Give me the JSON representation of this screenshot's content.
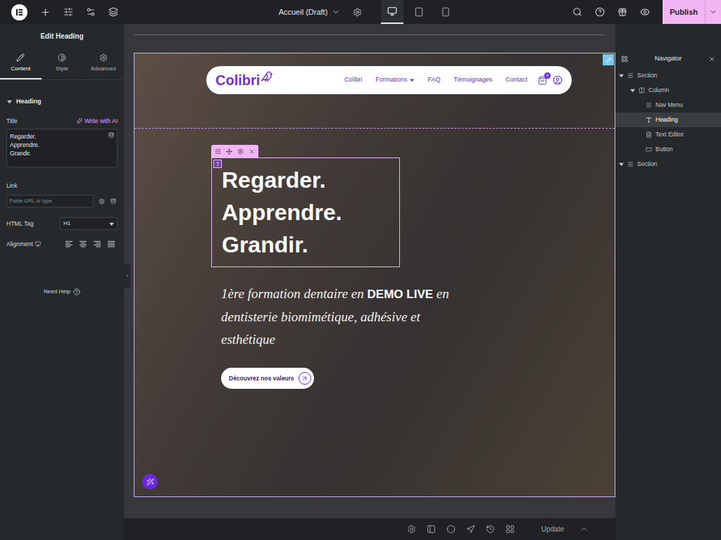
{
  "topbar": {
    "page_title": "Accueil (Draft)",
    "devices": [
      {
        "kind": "desktop",
        "selected": true
      },
      {
        "kind": "tablet",
        "selected": false
      },
      {
        "kind": "mobile",
        "selected": false
      }
    ],
    "publish": "Publish"
  },
  "panel": {
    "title": "Edit Heading",
    "tabs": [
      {
        "label": "Content",
        "kind": "content",
        "selected": true
      },
      {
        "label": "Style",
        "kind": "style",
        "selected": false
      },
      {
        "label": "Advanced",
        "kind": "advanced",
        "selected": false
      }
    ],
    "section": {
      "label": "Heading",
      "expanded": true
    },
    "title_field": {
      "label": "Title",
      "ai": "Write with AI",
      "value": "Regarder.\nApprendre.\nGrandir."
    },
    "link_field": {
      "label": "Link",
      "placeholder": "Paste URL or type"
    },
    "html_tag": {
      "label": "HTML Tag",
      "value": "H1"
    },
    "alignment": {
      "label": "Alignment",
      "options": [
        {
          "kind": "left",
          "selected": false
        },
        {
          "kind": "center",
          "selected": false
        },
        {
          "kind": "right",
          "selected": false
        },
        {
          "kind": "justify",
          "selected": false
        }
      ]
    },
    "help": "Need Help"
  },
  "preview": {
    "logo": "Colibri",
    "nav": [
      {
        "label": "Colibri",
        "dropdown": false
      },
      {
        "label": "Formations",
        "dropdown": true
      },
      {
        "label": "FAQ",
        "dropdown": false
      },
      {
        "label": "Témoignages",
        "dropdown": false
      },
      {
        "label": "Contact",
        "dropdown": false
      }
    ],
    "cart_count": "0",
    "heading": [
      "Regarder.",
      "Apprendre.",
      "Grandir."
    ],
    "heading_selected": true,
    "subtitle": {
      "before": "1ère formation dentaire en ",
      "bold": "DEMO LIVE",
      "after": " en dentisterie biomimétique, adhésive et esthétique"
    },
    "cta": "Découvrez nos valeurs"
  },
  "navigator": {
    "title": "Navigator",
    "items": [
      {
        "label": "Section",
        "kind": "section",
        "expanded": true,
        "selected": false
      },
      {
        "label": "Column",
        "kind": "column",
        "expanded": true,
        "selected": false
      },
      {
        "label": "Nav Menu",
        "kind": "nav-menu",
        "expanded": false,
        "selected": false
      },
      {
        "label": "Heading",
        "kind": "heading",
        "expanded": false,
        "selected": true
      },
      {
        "label": "Text Editor",
        "kind": "text-editor",
        "expanded": false,
        "selected": false
      },
      {
        "label": "Button",
        "kind": "button",
        "expanded": false,
        "selected": false
      },
      {
        "label": "Section",
        "kind": "section",
        "expanded": true,
        "selected": false
      }
    ]
  },
  "bottombar": {
    "update": "Update"
  }
}
